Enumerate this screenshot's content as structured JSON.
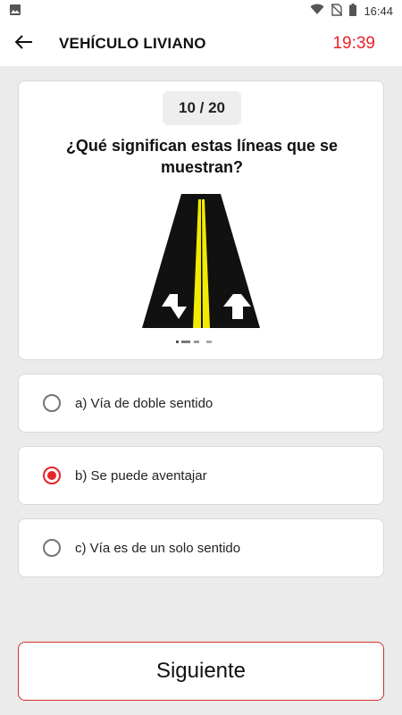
{
  "status_bar": {
    "time": "16:44",
    "icons": [
      "image-notification-icon",
      "wifi-icon",
      "no-sim-icon",
      "battery-icon"
    ]
  },
  "app_bar": {
    "back_icon": "arrow-left-icon",
    "title": "VEHÍCULO LIVIANO",
    "timer": "19:39"
  },
  "question": {
    "counter": "10 / 20",
    "text": "¿Qué significan estas líneas que se muestran?",
    "image": "road-with-yellow-center-lines-and-arrows"
  },
  "options": [
    {
      "label": "a) Vía de doble sentido",
      "selected": false
    },
    {
      "label": "b) Se puede aventajar",
      "selected": true
    },
    {
      "label": "c) Vía es de un solo sentido",
      "selected": false
    }
  ],
  "next_button": {
    "label": "Siguiente"
  },
  "colors": {
    "accent": "#e8232a",
    "background": "#ebebeb",
    "card": "#ffffff",
    "road": "#111111",
    "center_line": "#f2ea00"
  }
}
